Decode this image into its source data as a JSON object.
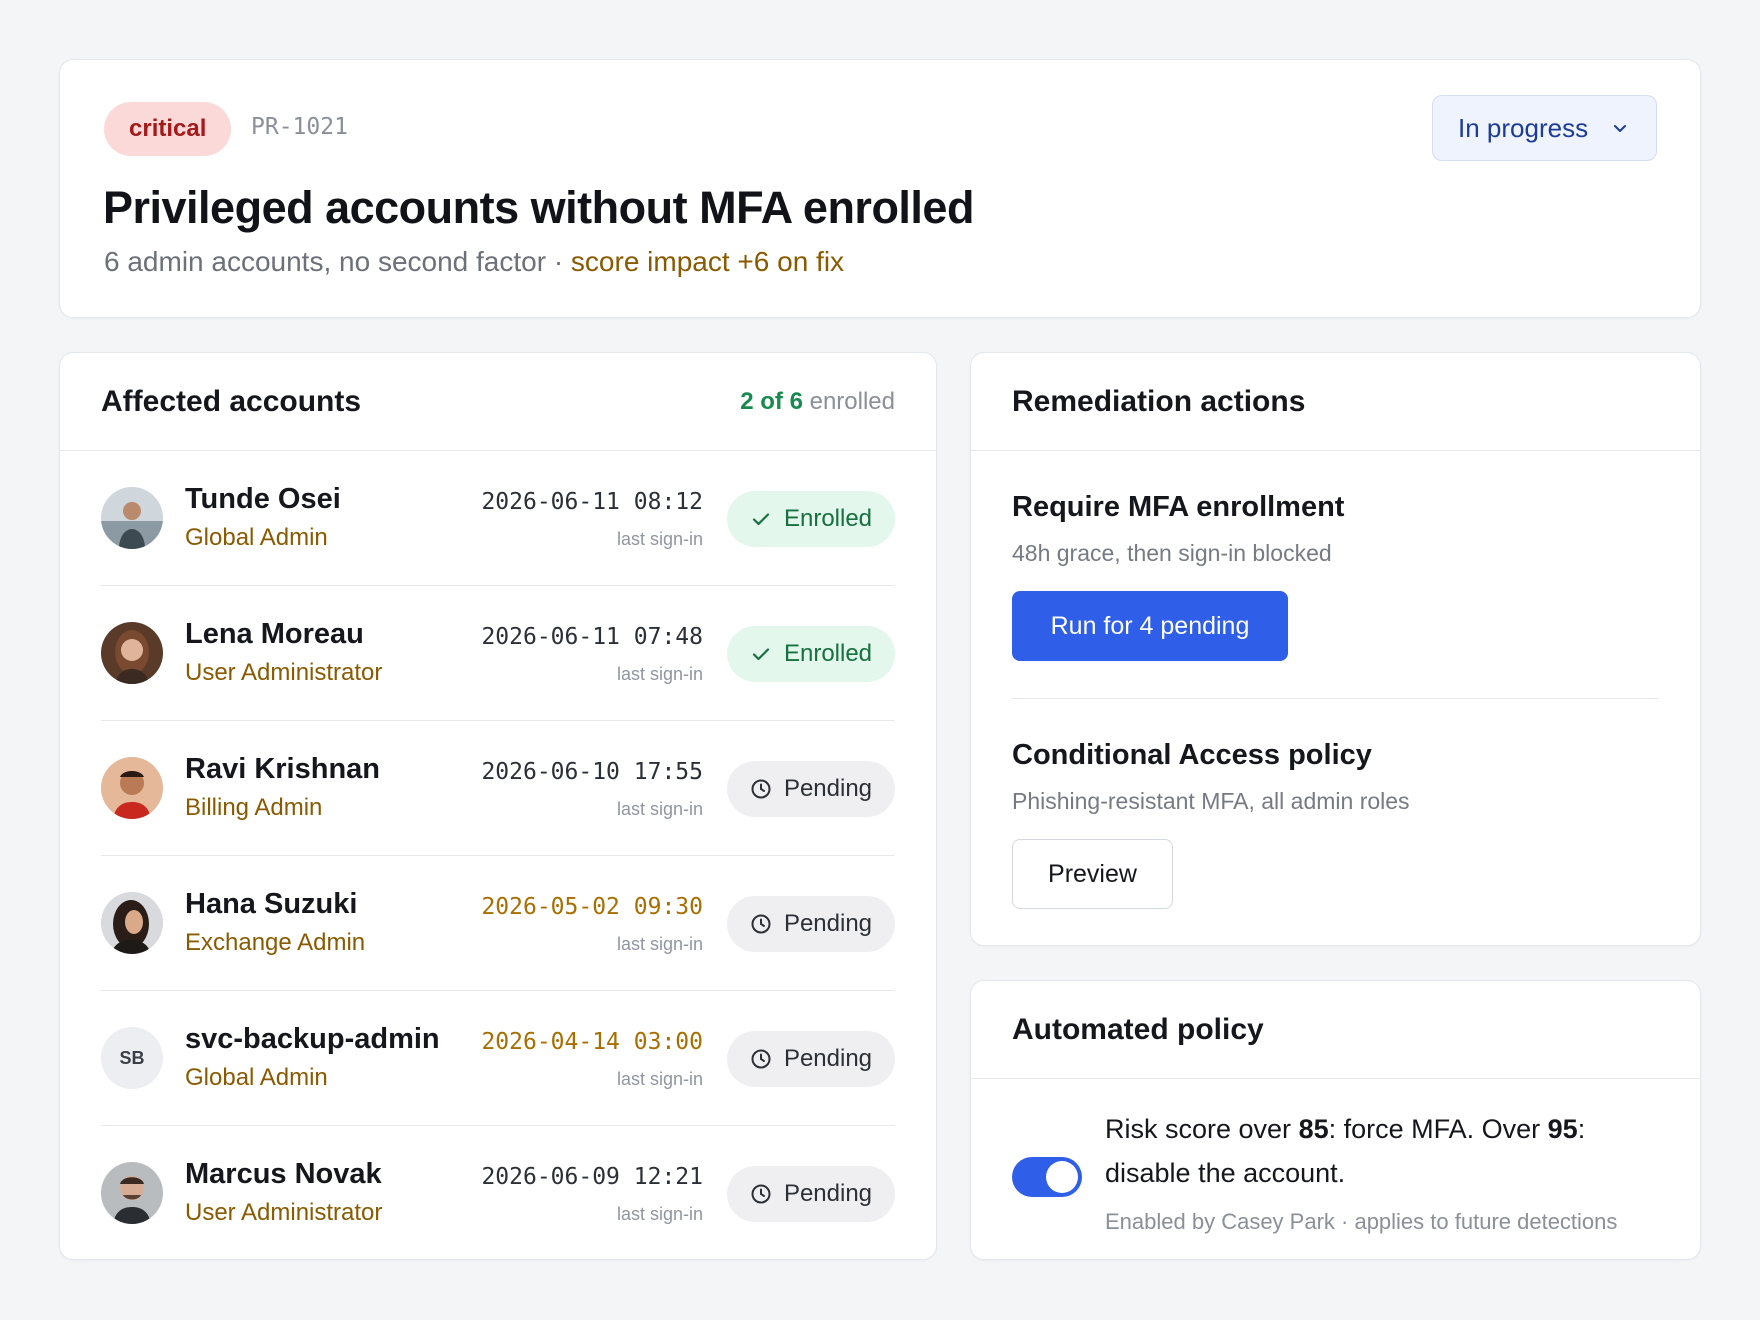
{
  "finding": {
    "severity": "critical",
    "id": "PR-1021",
    "status": "In progress",
    "title": "Privileged accounts without MFA enrolled",
    "subtitle_main": "6 admin accounts, no second factor · ",
    "subtitle_impact": "score impact +6 on fix"
  },
  "accounts": {
    "heading": "Affected accounts",
    "enrolled_count": "2 of 6",
    "enrolled_suffix": " enrolled",
    "signin_label": "last sign-in",
    "rows": [
      {
        "name": "Tunde Osei",
        "role": "Global Admin",
        "last_signin": "2026-06-11 08:12",
        "status": "Enrolled"
      },
      {
        "name": "Lena Moreau",
        "role": "User Administrator",
        "last_signin": "2026-06-11 07:48",
        "status": "Enrolled"
      },
      {
        "name": "Ravi Krishnan",
        "role": "Billing Admin",
        "last_signin": "2026-06-10 17:55",
        "status": "Pending"
      },
      {
        "name": "Hana Suzuki",
        "role": "Exchange Admin",
        "last_signin": "2026-05-02 09:30",
        "status": "Pending"
      },
      {
        "name": "svc-backup-admin",
        "role": "Global Admin",
        "last_signin": "2026-04-14 03:00",
        "status": "Pending",
        "initials": "SB"
      },
      {
        "name": "Marcus Novak",
        "role": "User Administrator",
        "last_signin": "2026-06-09 12:21",
        "status": "Pending"
      }
    ]
  },
  "remediation": {
    "heading": "Remediation actions",
    "mfa": {
      "title": "Require MFA enrollment",
      "description": "48h grace, then sign-in blocked",
      "button": "Run for 4 pending"
    },
    "ca": {
      "title": "Conditional Access policy",
      "description": "Phishing-resistant MFA, all admin roles",
      "button": "Preview"
    }
  },
  "policy": {
    "heading": "Automated policy",
    "enabled": true,
    "text_1": "Risk score over ",
    "threshold_1": "85",
    "text_2": ": force MFA. Over ",
    "threshold_2": "95",
    "text_3": ": disable the account.",
    "meta": "Enabled by Casey Park · applies to future detections"
  },
  "colors": {
    "accent": "#2f5ee8",
    "critical_bg": "#fbd9d9",
    "critical_text": "#a31a1a",
    "enrolled_bg": "#e3f7ec",
    "enrolled_text": "#17703f",
    "warning_text": "#8a5a00"
  },
  "icons": {
    "status_dropdown": "chevron-down-icon",
    "enrolled": "check-icon",
    "pending": "clock-icon"
  }
}
